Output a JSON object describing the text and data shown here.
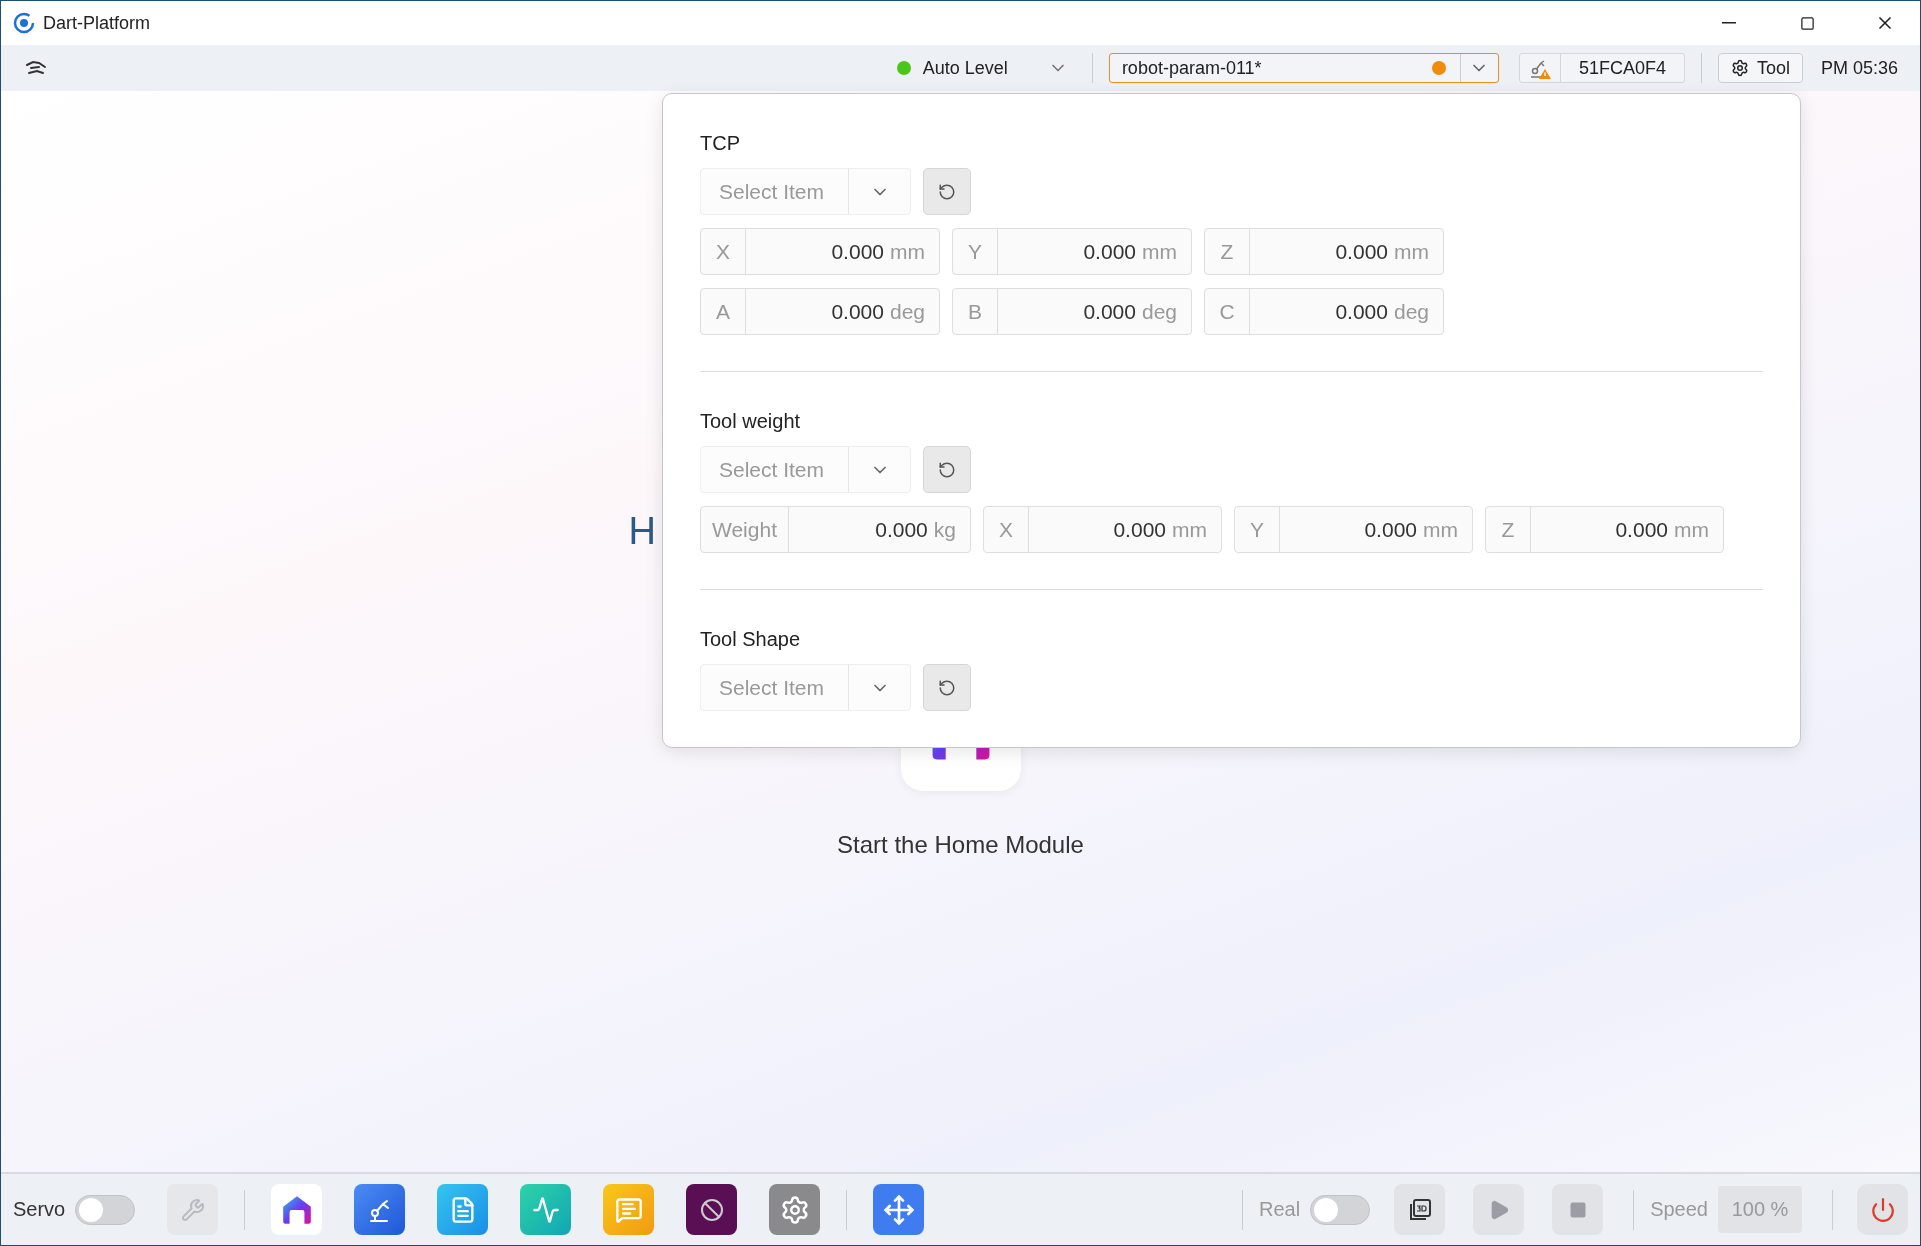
{
  "window": {
    "title": "Dart-Platform"
  },
  "toolbar": {
    "mode": {
      "label": "Auto Level",
      "connected": true
    },
    "parameter": {
      "value": "robot-param-011*",
      "modified": true
    },
    "robot_id": "51FCA0F4",
    "tool_button": "Tool",
    "time": "PM 05:36"
  },
  "home": {
    "heading": "H",
    "start_label": "Start the Home Module"
  },
  "tool_panel": {
    "sections": [
      {
        "title": "TCP",
        "select": {
          "placeholder": "Select Item"
        },
        "rows": [
          [
            {
              "label": "X",
              "value": "0.000",
              "unit": "mm"
            },
            {
              "label": "Y",
              "value": "0.000",
              "unit": "mm"
            },
            {
              "label": "Z",
              "value": "0.000",
              "unit": "mm"
            }
          ],
          [
            {
              "label": "A",
              "value": "0.000",
              "unit": "deg"
            },
            {
              "label": "B",
              "value": "0.000",
              "unit": "deg"
            },
            {
              "label": "C",
              "value": "0.000",
              "unit": "deg"
            }
          ]
        ]
      },
      {
        "title": "Tool weight",
        "select": {
          "placeholder": "Select Item"
        },
        "rows": [
          [
            {
              "label": "Weight",
              "value": "0.000",
              "unit": "kg"
            },
            {
              "label": "X",
              "value": "0.000",
              "unit": "mm"
            },
            {
              "label": "Y",
              "value": "0.000",
              "unit": "mm"
            },
            {
              "label": "Z",
              "value": "0.000",
              "unit": "mm"
            }
          ]
        ]
      },
      {
        "title": "Tool Shape",
        "select": {
          "placeholder": "Select Item"
        }
      }
    ]
  },
  "bottom_bar": {
    "servo": {
      "label": "Servo",
      "on": false
    },
    "apps": [
      {
        "kind": "wrench",
        "disabled": true
      },
      {
        "kind": "divider"
      },
      {
        "kind": "home",
        "disabled": false
      },
      {
        "kind": "robot",
        "disabled": false
      },
      {
        "kind": "document",
        "disabled": false
      },
      {
        "kind": "monitor",
        "disabled": false
      },
      {
        "kind": "chat",
        "disabled": false
      },
      {
        "kind": "block",
        "disabled": false
      },
      {
        "kind": "settings",
        "disabled": false
      },
      {
        "kind": "divider"
      },
      {
        "kind": "move",
        "disabled": false
      }
    ],
    "real": {
      "label": "Real",
      "on": false
    },
    "run_controls": [
      {
        "kind": "view3d",
        "disabled": false
      },
      {
        "kind": "play",
        "disabled": true
      },
      {
        "kind": "stop",
        "disabled": true
      }
    ],
    "speed": {
      "label": "Speed",
      "value": "100 %"
    }
  }
}
